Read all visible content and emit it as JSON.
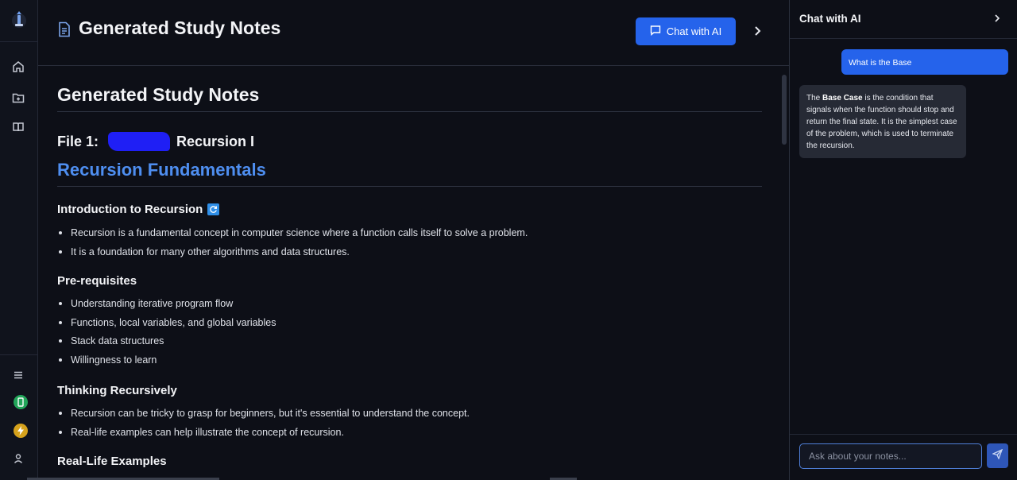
{
  "header": {
    "title": "Generated Study Notes",
    "chat_button_label": "Chat with AI"
  },
  "rail": {
    "icons": [
      "logo-icon",
      "home-icon",
      "folder-plus-icon",
      "book-icon",
      "menu-icon",
      "phone-icon",
      "lightning-icon",
      "user-icon"
    ]
  },
  "notes": {
    "heading": "Generated Study Notes",
    "file_prefix": "File 1:",
    "file_title": "Recursion I",
    "section_title": "Recursion Fundamentals",
    "sections": [
      {
        "title": "Introduction to Recursion",
        "items": [
          "Recursion is a fundamental concept in computer science where a function calls itself to solve a problem.",
          "It is a foundation for many other algorithms and data structures."
        ]
      },
      {
        "title": "Pre-requisites",
        "items": [
          "Understanding iterative program flow",
          "Functions, local variables, and global variables",
          "Stack data structures",
          "Willingness to learn"
        ]
      },
      {
        "title": "Thinking Recursively",
        "items": [
          "Recursion can be tricky to grasp for beginners, but it's essential to understand the concept.",
          "Real-life examples can help illustrate the concept of recursion."
        ]
      },
      {
        "title": "Real-Life Examples",
        "items": []
      }
    ]
  },
  "chat": {
    "title": "Chat with AI",
    "user_message": "What is the Base",
    "ai_message": {
      "pre": "The ",
      "bold": "Base Case",
      "post": " is the condition that signals when the function should stop and return the final state. It is the simplest case of the problem, which is used to terminate the recursion."
    },
    "input_placeholder": "Ask about your notes...",
    "input_value": ""
  },
  "colors": {
    "accent": "#2563eb",
    "heading_blue": "#4e8ef0",
    "background": "#0d0f17",
    "ai_bubble": "#262a35"
  }
}
